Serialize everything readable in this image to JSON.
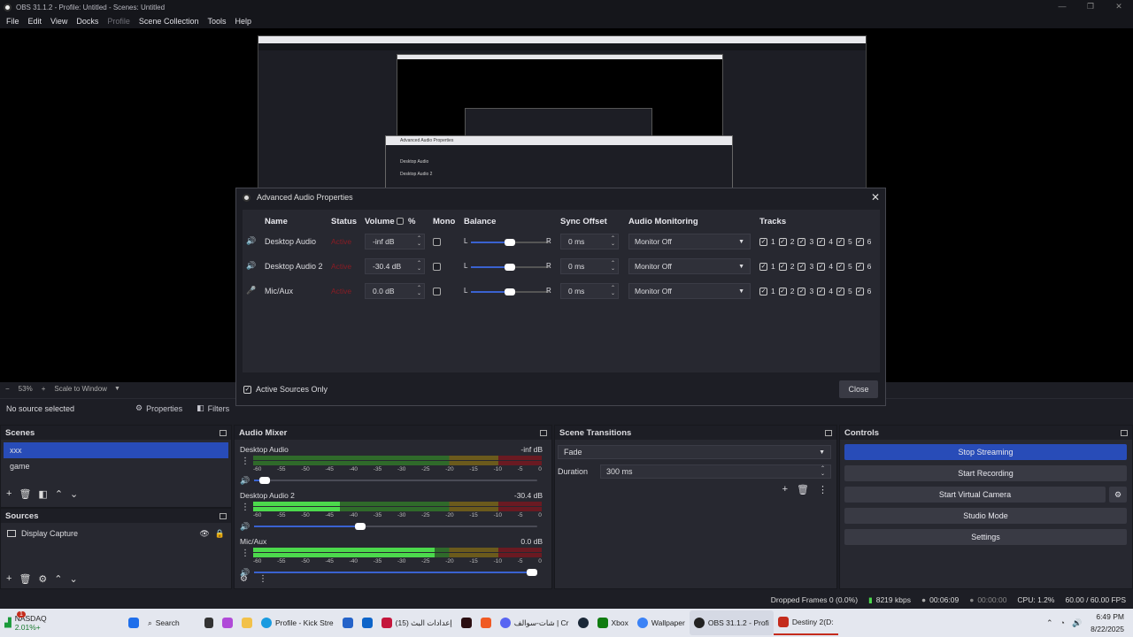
{
  "window": {
    "title": "OBS 31.1.2 - Profile: Untitled - Scenes: Untitled",
    "min": "—",
    "max": "❐",
    "close": "✕"
  },
  "menu": [
    "File",
    "Edit",
    "View",
    "Docks",
    "Profile",
    "Scene Collection",
    "Tools",
    "Help"
  ],
  "preview": {
    "zoom": "53%",
    "scale_mode": "Scale to Window",
    "minus": "−",
    "plus": "+"
  },
  "source_bar": {
    "no_source": "No source selected",
    "properties": "Properties",
    "filters": "Filters"
  },
  "scenes": {
    "title": "Scenes",
    "items": [
      "xxx",
      "game"
    ],
    "selected": 0
  },
  "sources": {
    "title": "Sources",
    "items": [
      {
        "name": "Display Capture"
      }
    ]
  },
  "mixer": {
    "title": "Audio Mixer",
    "channels": [
      {
        "name": "Desktop Audio",
        "db": "-inf dB",
        "volume": 0.02,
        "level": 0.0
      },
      {
        "name": "Desktop Audio 2",
        "db": "-30.4 dB",
        "volume": 0.37,
        "level": 0.3
      },
      {
        "name": "Mic/Aux",
        "db": "0.0 dB",
        "volume": 1.0,
        "level": 0.63
      }
    ],
    "ticks": [
      "-60",
      "-55",
      "-50",
      "-45",
      "-40",
      "-35",
      "-30",
      "-25",
      "-20",
      "-15",
      "-10",
      "-5",
      "0"
    ]
  },
  "transitions": {
    "title": "Scene Transitions",
    "type": "Fade",
    "duration_label": "Duration",
    "duration": "300 ms"
  },
  "controls": {
    "title": "Controls",
    "buttons": [
      "Stop Streaming",
      "Start Recording",
      "Start Virtual Camera",
      "Studio Mode",
      "Settings"
    ]
  },
  "status": {
    "dropped": "Dropped Frames 0 (0.0%)",
    "bitrate": "8219 kbps",
    "stream_time": "00:06:09",
    "rec_time": "00:00:00",
    "cpu": "CPU: 1.2%",
    "fps": "60.00 / 60.00 FPS"
  },
  "dialog": {
    "title": "Advanced Audio Properties",
    "headers": {
      "name": "Name",
      "status": "Status",
      "volume": "Volume",
      "percent": "%",
      "mono": "Mono",
      "balance": "Balance",
      "sync": "Sync Offset",
      "monitoring": "Audio Monitoring",
      "tracks": "Tracks"
    },
    "rows": [
      {
        "name": "Desktop Audio",
        "status": "Active",
        "volume": "-inf dB",
        "balance": 0.5,
        "sync": "0 ms",
        "monitoring": "Monitor Off"
      },
      {
        "name": "Desktop Audio 2",
        "status": "Active",
        "volume": "-30.4 dB",
        "balance": 0.5,
        "sync": "0 ms",
        "monitoring": "Monitor Off"
      },
      {
        "name": "Mic/Aux",
        "status": "Active",
        "volume": "0.0 dB",
        "balance": 0.5,
        "sync": "0 ms",
        "monitoring": "Monitor Off"
      }
    ],
    "bal_l": "L",
    "bal_r": "R",
    "tracks": [
      "1",
      "2",
      "3",
      "4",
      "5",
      "6"
    ],
    "active_only": "Active Sources Only",
    "close": "Close"
  },
  "taskbar": {
    "ticker": "NASDAQ",
    "ticker_change": "2.01%+",
    "badge": "1",
    "search": "Search",
    "items": [
      "Profile - Kick Stre",
      "إعدادات البث (15)",
      "شات-سوالف | Cr",
      "Xbox",
      "Wallpaper",
      "OBS 31.1.2 - Profi",
      "Destiny 2(D:"
    ],
    "time": "6:49 PM",
    "date": "8/22/2025"
  }
}
